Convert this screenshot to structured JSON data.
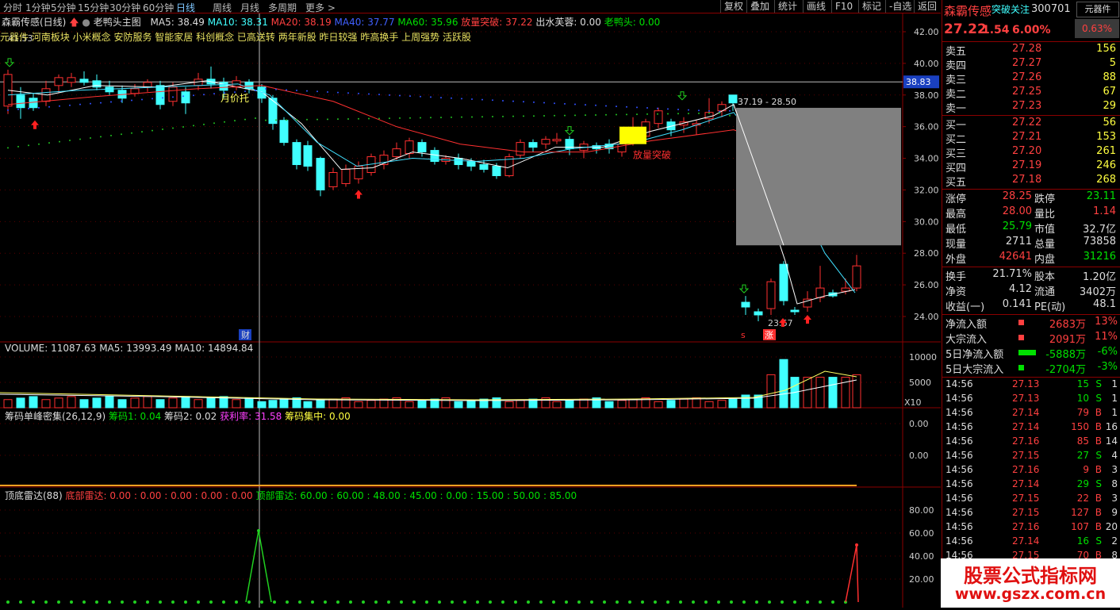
{
  "timeframes": [
    "分时",
    "1分钟",
    "5分钟",
    "15分钟",
    "30分钟",
    "60分钟",
    "日线",
    "周线",
    "月线",
    "多周期",
    "更多 >"
  ],
  "active_timeframe_index": 6,
  "tools": [
    "复权",
    "叠加",
    "统计",
    "画线",
    "F10",
    "标记",
    "-自选",
    "返回"
  ],
  "main_header": {
    "stock": "森霸传感(日线)",
    "formula": "老鸭头主图",
    "ma5": "MA5: 38.49",
    "ma10": "MA10: 38.31",
    "ma20": "MA20: 38.19",
    "ma40": "MA40: 37.77",
    "ma60": "MA60: 35.96",
    "breakout": "放量突破: 37.22",
    "chushui": "出水芙蓉: 0.00",
    "laoyatou": "老鸭头: 0.00"
  },
  "concepts": "元器件 河南板块 小米概念 安防服务 智能家居 科创概念 已高送转 两年新股 昨日较强 昨高换手 上周强势 活跃股",
  "price_axis": [
    "42.00",
    "40.00",
    "38.00",
    "36.00",
    "34.00",
    "32.00",
    "30.00",
    "28.00",
    "26.00",
    "24.00"
  ],
  "crosshair_price": "38.83",
  "annotations": {
    "high_label": "41.53",
    "month_support": "月价托",
    "breakout_text": "放量突破",
    "range_label": "37.19 - 28.50",
    "low_label": "23.67",
    "cai": "财",
    "zhang": "涨",
    "s": "s",
    "x10": "X10"
  },
  "volume": {
    "header_name": "VOLUME: 11087.63",
    "ma5": "MA5: 13993.49",
    "ma10": "MA10: 14894.84",
    "axis": [
      "10000",
      "5000"
    ]
  },
  "chip": {
    "header_name": "筹码单峰密集(26,12,9)",
    "c1": "筹码1: 0.04",
    "c2": "筹码2: 0.02",
    "profit": "获利率: 31.58",
    "focus": "筹码集中: 0.00",
    "axis": [
      "0.00",
      "0.00"
    ]
  },
  "radar": {
    "header_name": "顶底雷达(88)",
    "bottom": "底部雷达: 0.00 : 0.00 : 0.00 : 0.00 : 0.00",
    "top": "顶部雷达: 60.00 : 60.00 : 48.00 : 45.00 : 0.00 : 15.00 : 50.00 : 85.00",
    "axis": [
      "80.00",
      "60.00",
      "40.00",
      "20.00"
    ]
  },
  "quote": {
    "name": "森霸传感",
    "watch": "突破关注",
    "code": "300701",
    "sector_btn": "元器件",
    "price": "27.22",
    "change": "1.54",
    "pct": "6.00%",
    "sector_pct": "0.63%",
    "asks": [
      {
        "label": "卖五",
        "price": "27.28",
        "vol": "156"
      },
      {
        "label": "卖四",
        "price": "27.27",
        "vol": "5"
      },
      {
        "label": "卖三",
        "price": "27.26",
        "vol": "88"
      },
      {
        "label": "卖二",
        "price": "27.25",
        "vol": "67"
      },
      {
        "label": "卖一",
        "price": "27.23",
        "vol": "29"
      }
    ],
    "bids": [
      {
        "label": "买一",
        "price": "27.22",
        "vol": "56"
      },
      {
        "label": "买二",
        "price": "27.21",
        "vol": "153"
      },
      {
        "label": "买三",
        "price": "27.20",
        "vol": "261"
      },
      {
        "label": "买四",
        "price": "27.19",
        "vol": "246"
      },
      {
        "label": "买五",
        "price": "27.18",
        "vol": "268"
      }
    ],
    "stats": [
      {
        "l1": "涨停",
        "v1": "28.25",
        "l2": "跌停",
        "v2": "23.11"
      },
      {
        "l1": "最高",
        "v1": "28.00",
        "l2": "量比",
        "v2": "1.14"
      },
      {
        "l1": "最低",
        "v1": "25.79",
        "l2": "市值",
        "v2": "32.7亿"
      },
      {
        "l1": "现量",
        "v1": "2711",
        "l2": "总量",
        "v2": "73858"
      },
      {
        "l1": "外盘",
        "v1": "42641",
        "l2": "内盘",
        "v2": "31216"
      }
    ],
    "stats2": [
      {
        "l1": "换手",
        "v1": "21.71%",
        "l2": "股本",
        "v2": "1.20亿"
      },
      {
        "l1": "净资",
        "v1": "4.12",
        "l2": "流通",
        "v2": "3402万"
      },
      {
        "l1": "收益(一)",
        "v1": "0.141",
        "l2": "PE(动)",
        "v2": "48.1"
      }
    ],
    "flows": [
      {
        "label": "净流入额",
        "val": "2683万",
        "pct": "13%"
      },
      {
        "label": "大宗流入",
        "val": "2091万",
        "pct": "11%"
      },
      {
        "label": "5日净流入额",
        "val": "-5888万",
        "pct": "-6%"
      },
      {
        "label": "5日大宗流入",
        "val": "-2704万",
        "pct": "-3%"
      }
    ],
    "ticks": [
      {
        "t": "14:56",
        "p": "27.13",
        "v": "15",
        "d": "S",
        "n": "1"
      },
      {
        "t": "14:56",
        "p": "27.13",
        "v": "10",
        "d": "S",
        "n": "1"
      },
      {
        "t": "14:56",
        "p": "27.14",
        "v": "79",
        "d": "B",
        "n": "1"
      },
      {
        "t": "14:56",
        "p": "27.14",
        "v": "150",
        "d": "B",
        "n": "16"
      },
      {
        "t": "14:56",
        "p": "27.16",
        "v": "85",
        "d": "B",
        "n": "14"
      },
      {
        "t": "14:56",
        "p": "27.15",
        "v": "27",
        "d": "S",
        "n": "4"
      },
      {
        "t": "14:56",
        "p": "27.16",
        "v": "9",
        "d": "B",
        "n": "3"
      },
      {
        "t": "14:56",
        "p": "27.14",
        "v": "29",
        "d": "S",
        "n": "8"
      },
      {
        "t": "14:56",
        "p": "27.15",
        "v": "22",
        "d": "B",
        "n": "3"
      },
      {
        "t": "14:56",
        "p": "27.15",
        "v": "127",
        "d": "B",
        "n": "9"
      },
      {
        "t": "14:56",
        "p": "27.16",
        "v": "107",
        "d": "B",
        "n": "20"
      },
      {
        "t": "14:56",
        "p": "27.14",
        "v": "16",
        "d": "S",
        "n": "2"
      },
      {
        "t": "14:56",
        "p": "27.15",
        "v": "70",
        "d": "B",
        "n": "8"
      }
    ]
  },
  "watermark": {
    "cn": "股票公式指标网",
    "url": "www.gszx.com.cn"
  }
}
